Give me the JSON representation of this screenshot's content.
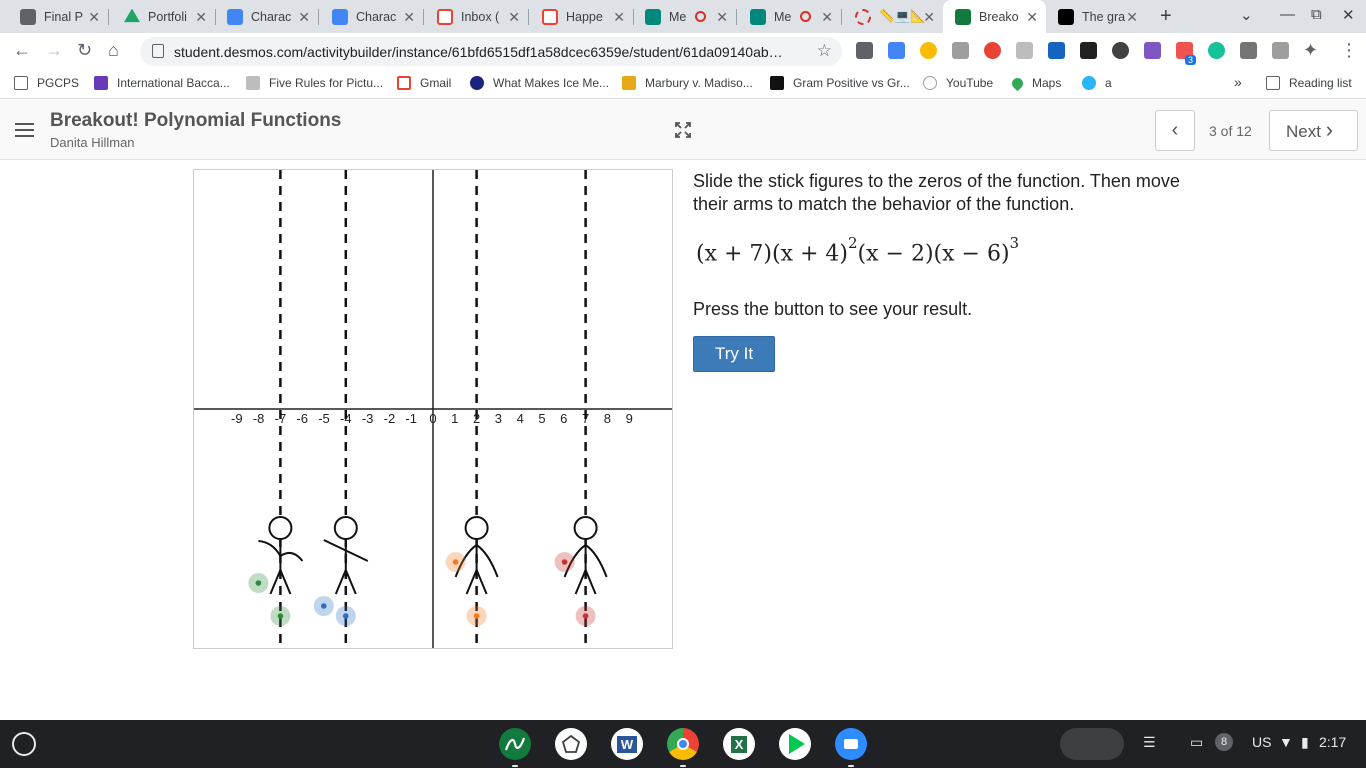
{
  "browser": {
    "tabs": [
      {
        "label": "Final P",
        "icon": "contact-card-icon",
        "color": "#5f6368"
      },
      {
        "label": "Portfoli",
        "icon": "google-drive-icon",
        "color": "#1fa463"
      },
      {
        "label": "Charac",
        "icon": "google-docs-icon",
        "color": "#4285f4"
      },
      {
        "label": "Charac",
        "icon": "google-docs-icon",
        "color": "#4285f4"
      },
      {
        "label": "Inbox (",
        "icon": "gmail-icon",
        "color": "#ea4335"
      },
      {
        "label": "Happe",
        "icon": "gmail-icon",
        "color": "#ea4335"
      },
      {
        "label": "Me",
        "icon": "google-meet-icon",
        "color": "#00897b",
        "recording": true
      },
      {
        "label": "Me",
        "icon": "google-meet-icon",
        "color": "#00897b",
        "recording": true
      },
      {
        "label": "📏💻📐",
        "icon": "loading-icon",
        "color": "#d93025"
      },
      {
        "label": "Breako",
        "icon": "desmos-icon",
        "color": "#127a3d",
        "active": true
      },
      {
        "label": "The gra",
        "icon": "brainly-icon",
        "color": "#000000"
      }
    ],
    "url": "student.desmos.com/activitybuilder/instance/61bfd6515df1a58dcec6359e/student/61da09140ab…",
    "bookmarks": [
      {
        "label": "PGCPS",
        "icon": "folder-icon",
        "color": "#5f6368"
      },
      {
        "label": "International Bacca...",
        "icon": "forms-icon",
        "color": "#673ab7"
      },
      {
        "label": "Five Rules for Pictu...",
        "icon": "page-icon",
        "color": "#bdbdbd"
      },
      {
        "label": "Gmail",
        "icon": "gmail-icon",
        "color": "#ea4335"
      },
      {
        "label": "What Makes Ice Me...",
        "icon": "globe-icon",
        "color": "#1a237e"
      },
      {
        "label": "Marbury v. Madiso...",
        "icon": "history-icon",
        "color": "#e6a817"
      },
      {
        "label": "Gram Positive vs Gr...",
        "icon": "tn-icon",
        "color": "#111111"
      },
      {
        "label": "YouTube",
        "icon": "ck12-icon",
        "color": "#9e9e9e"
      },
      {
        "label": "Maps",
        "icon": "maps-pin-icon",
        "color": "#34a853"
      },
      {
        "label": "a",
        "icon": "edge-icon",
        "color": "#29b6f6"
      }
    ],
    "reading_list": "Reading list",
    "more_bookmarks": "»",
    "ext_badge": "3"
  },
  "header": {
    "title": "Breakout! Polynomial Functions",
    "student": "Danita Hillman",
    "page_indicator": "3 of 12",
    "next_label": "Next"
  },
  "graph": {
    "x_ticks": [
      "-9",
      "-8",
      "-7",
      "-6",
      "-5",
      "-4",
      "-3",
      "-2",
      "-1",
      "0",
      "1",
      "2",
      "3",
      "4",
      "5",
      "6",
      "7",
      "8",
      "9"
    ],
    "dashed_lines_x": [
      -7,
      -4,
      2,
      7
    ],
    "figures": [
      {
        "x": -7,
        "color": "#2e8b3e",
        "pose": "arms-up-left",
        "label": "figure-green"
      },
      {
        "x": -4,
        "color": "#2f6fbd",
        "pose": "arms-diagonal",
        "label": "figure-blue"
      },
      {
        "x": 2,
        "color": "#ee7a21",
        "pose": "arms-down",
        "label": "figure-orange"
      },
      {
        "x": 7,
        "color": "#c83232",
        "pose": "arms-down",
        "label": "figure-red"
      }
    ]
  },
  "panel": {
    "instruction": "Slide the stick figures to the zeros of the function. Then move their arms to match the behavior of the function.",
    "f1": "(x + 7)",
    "f2": "(x + 4)",
    "e2": "2",
    "f3": "(x − 2)",
    "f4": "(x − 6)",
    "e4": "3",
    "press_text": "Press the button to see your result.",
    "button": "Try It"
  },
  "shelf": {
    "apps": [
      {
        "icon": "desmos-icon",
        "color": "#127a3d"
      },
      {
        "icon": "settings-icon",
        "color": "#e8eaed"
      },
      {
        "icon": "word-icon",
        "color": "#2b579a"
      },
      {
        "icon": "chrome-icon",
        "color": "#4285f4"
      },
      {
        "icon": "excel-icon",
        "color": "#217346"
      },
      {
        "icon": "play-store-icon",
        "color": "#00c853"
      },
      {
        "icon": "zoom-icon",
        "color": "#2d8cff"
      }
    ],
    "notification_count": "8",
    "locale": "US",
    "time": "2:17"
  }
}
